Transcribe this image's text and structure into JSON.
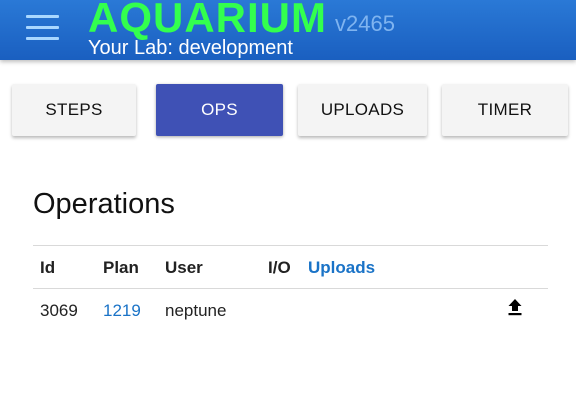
{
  "header": {
    "brand": "AQUARIUM",
    "version": "v2465",
    "lab": "Your Lab: development",
    "menu_icon": "hamburger-menu-icon",
    "colors": {
      "bar": "#1f68c9",
      "brand": "#33ff4e",
      "version": "#7fb4f0"
    }
  },
  "tabs": [
    {
      "label": "STEPS",
      "active": false
    },
    {
      "label": "OPS",
      "active": true
    },
    {
      "label": "UPLOADS",
      "active": false
    },
    {
      "label": "TIMER",
      "active": false
    }
  ],
  "operations": {
    "title": "Operations",
    "columns": [
      "Id",
      "Plan",
      "User",
      "I/O",
      "Uploads"
    ],
    "rows": [
      {
        "id": "3069",
        "plan": "1219",
        "user": "neptune",
        "io": "",
        "upload_icon": "upload-icon"
      }
    ]
  },
  "accent_color": "#3f51b5",
  "link_color": "#1a73c7"
}
